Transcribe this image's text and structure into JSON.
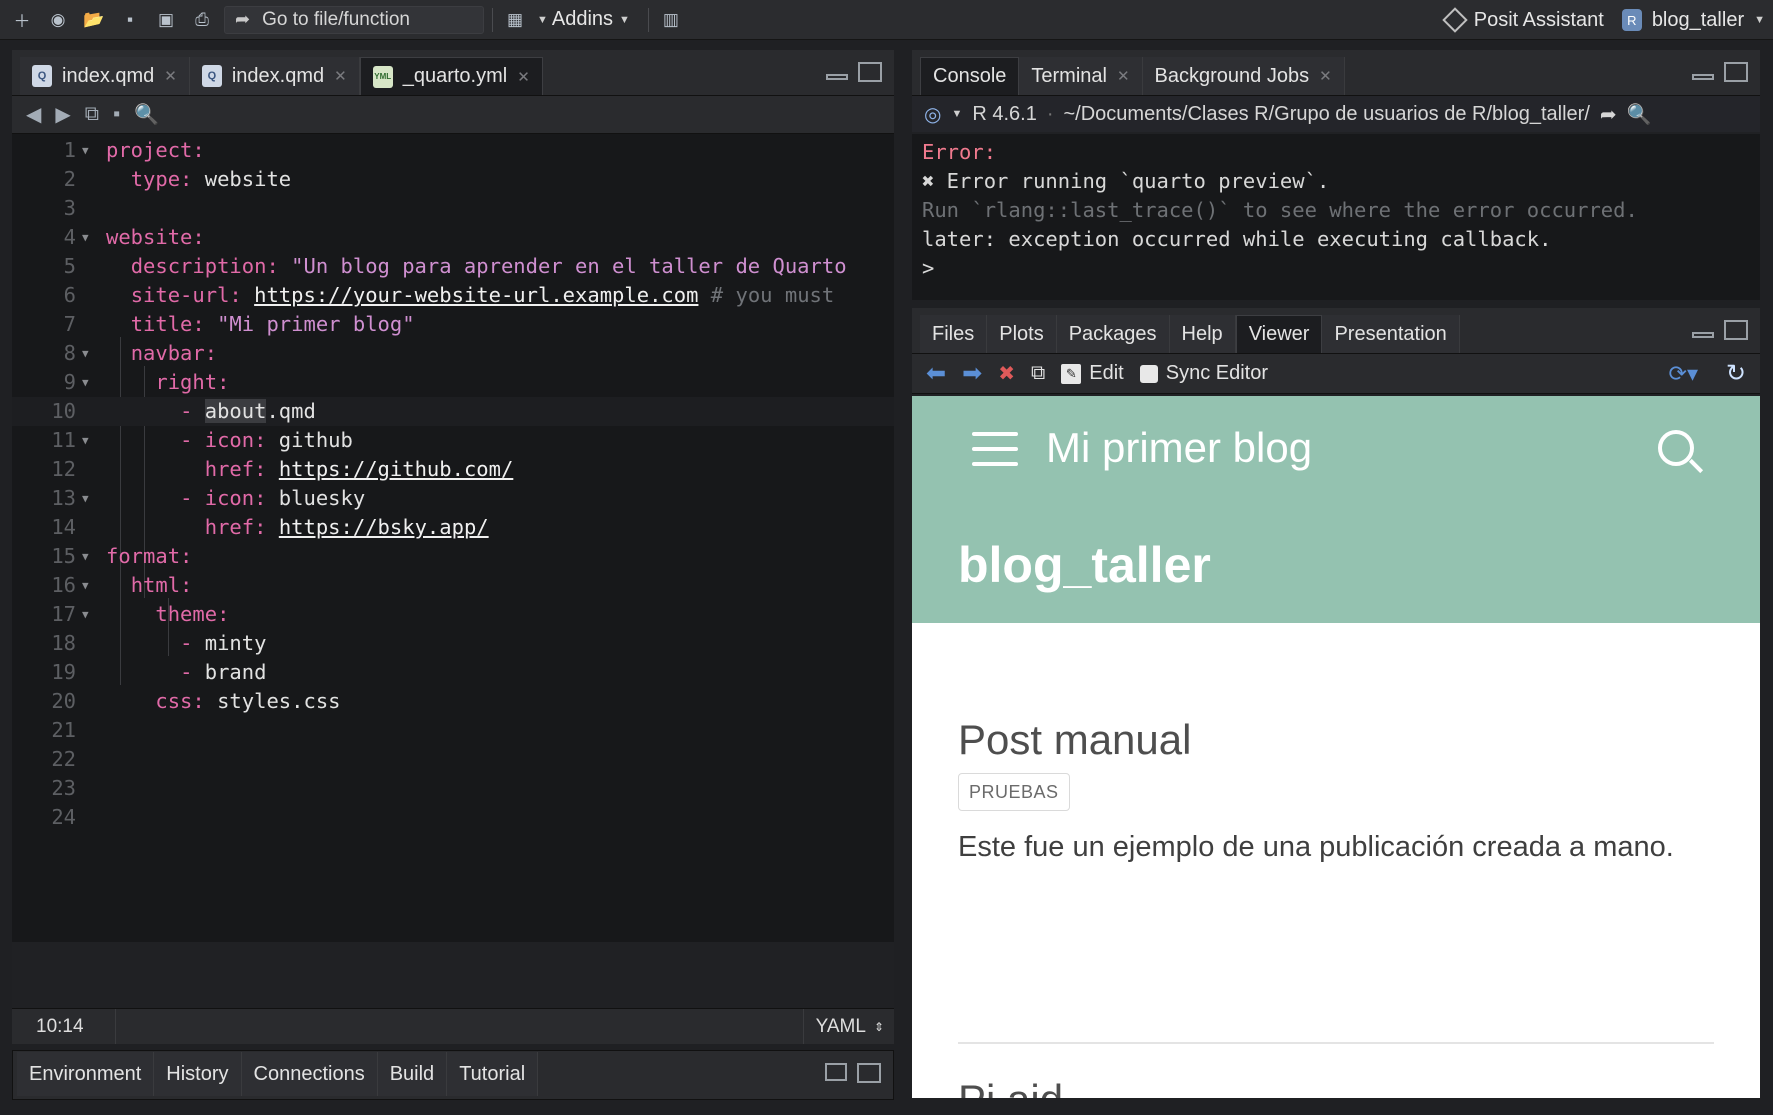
{
  "toolbar": {
    "goto_label": "Go to file/function",
    "addins_label": "Addins",
    "assistant_label": "Posit Assistant",
    "project_label": "blog_taller"
  },
  "editor": {
    "tabs": [
      {
        "label": "index.qmd"
      },
      {
        "label": "index.qmd"
      },
      {
        "label": "_quarto.yml"
      }
    ],
    "lines": [
      {
        "n": "1",
        "indent": "",
        "parts": [
          [
            "k",
            "project:"
          ]
        ],
        "fold": true
      },
      {
        "n": "2",
        "indent": "  ",
        "parts": [
          [
            "k",
            "type:"
          ],
          [
            "t",
            " website"
          ]
        ]
      },
      {
        "n": "3",
        "indent": "",
        "parts": []
      },
      {
        "n": "4",
        "indent": "",
        "parts": [
          [
            "k",
            "website:"
          ]
        ],
        "fold": true
      },
      {
        "n": "5",
        "indent": "  ",
        "parts": [
          [
            "k",
            "description:"
          ],
          [
            "s",
            " \"Un blog para aprender en el taller de Quarto"
          ]
        ]
      },
      {
        "n": "6",
        "indent": "  ",
        "parts": [
          [
            "k",
            "site-url:"
          ],
          [
            "t",
            " "
          ],
          [
            "u",
            "https://your-website-url.example.com"
          ],
          [
            "c",
            " # you must"
          ]
        ]
      },
      {
        "n": "7",
        "indent": "  ",
        "parts": [
          [
            "k",
            "title:"
          ],
          [
            "s",
            " \"Mi primer blog\""
          ]
        ]
      },
      {
        "n": "8",
        "indent": "  ",
        "parts": [
          [
            "k",
            "navbar:"
          ]
        ],
        "fold": true
      },
      {
        "n": "9",
        "indent": "    ",
        "parts": [
          [
            "k",
            "right:"
          ]
        ],
        "fold": true
      },
      {
        "n": "10",
        "indent": "      ",
        "parts": [
          [
            "k",
            "- "
          ],
          [
            "h",
            "about"
          ],
          [
            "t",
            ".qmd"
          ]
        ],
        "current": true
      },
      {
        "n": "11",
        "indent": "      ",
        "parts": [
          [
            "k",
            "- icon:"
          ],
          [
            "t",
            " github"
          ]
        ],
        "fold": true
      },
      {
        "n": "12",
        "indent": "        ",
        "parts": [
          [
            "k",
            "href:"
          ],
          [
            "t",
            " "
          ],
          [
            "u",
            "https://github.com/"
          ]
        ]
      },
      {
        "n": "13",
        "indent": "      ",
        "parts": [
          [
            "k",
            "- icon:"
          ],
          [
            "t",
            " bluesky"
          ]
        ],
        "fold": true
      },
      {
        "n": "14",
        "indent": "        ",
        "parts": [
          [
            "k",
            "href:"
          ],
          [
            "t",
            " "
          ],
          [
            "u",
            "https://bsky.app/"
          ]
        ]
      },
      {
        "n": "15",
        "indent": "",
        "parts": [
          [
            "k",
            "format:"
          ]
        ],
        "fold": true
      },
      {
        "n": "16",
        "indent": "  ",
        "parts": [
          [
            "k",
            "html:"
          ]
        ],
        "fold": true
      },
      {
        "n": "17",
        "indent": "    ",
        "parts": [
          [
            "k",
            "theme:"
          ]
        ],
        "fold": true
      },
      {
        "n": "18",
        "indent": "      ",
        "parts": [
          [
            "k",
            "- "
          ],
          [
            "t",
            "minty"
          ]
        ]
      },
      {
        "n": "19",
        "indent": "      ",
        "parts": [
          [
            "k",
            "- "
          ],
          [
            "t",
            "brand"
          ]
        ]
      },
      {
        "n": "20",
        "indent": "    ",
        "parts": [
          [
            "k",
            "css:"
          ],
          [
            "t",
            " styles.css"
          ]
        ]
      },
      {
        "n": "21",
        "indent": "",
        "parts": []
      },
      {
        "n": "22",
        "indent": "",
        "parts": []
      },
      {
        "n": "23",
        "indent": "",
        "parts": []
      },
      {
        "n": "24",
        "indent": "",
        "parts": []
      }
    ],
    "cursor_pos": "10:14",
    "language": "YAML"
  },
  "env_tabs": [
    "Environment",
    "History",
    "Connections",
    "Build",
    "Tutorial"
  ],
  "console": {
    "tabs": [
      {
        "label": "Console"
      },
      {
        "label": "Terminal"
      },
      {
        "label": "Background Jobs"
      }
    ],
    "r_version": "R 4.6.1",
    "path": "~/Documents/Clases R/Grupo de usuarios de R/blog_taller/",
    "lines": {
      "error_header": "Error:",
      "error_msg": "✖ Error running `quarto preview`.",
      "hint": "Run `rlang::last_trace()` to see where the error occurred.",
      "later": "later: exception occurred while executing callback.",
      "prompt": ">"
    }
  },
  "viewer": {
    "tabs": [
      "Files",
      "Plots",
      "Packages",
      "Help",
      "Viewer",
      "Presentation"
    ],
    "active_tab": "Viewer",
    "edit_label": "Edit",
    "sync_label": "Sync Editor",
    "site": {
      "brand": "Mi primer blog",
      "title": "blog_taller",
      "post_title": "Post manual",
      "badge": "PRUEBAS",
      "post_text": "Este fue un ejemplo de una publicación creada a mano.",
      "next_post_partial": "Pi      aid",
      "header_color": "#94c2b0"
    }
  }
}
